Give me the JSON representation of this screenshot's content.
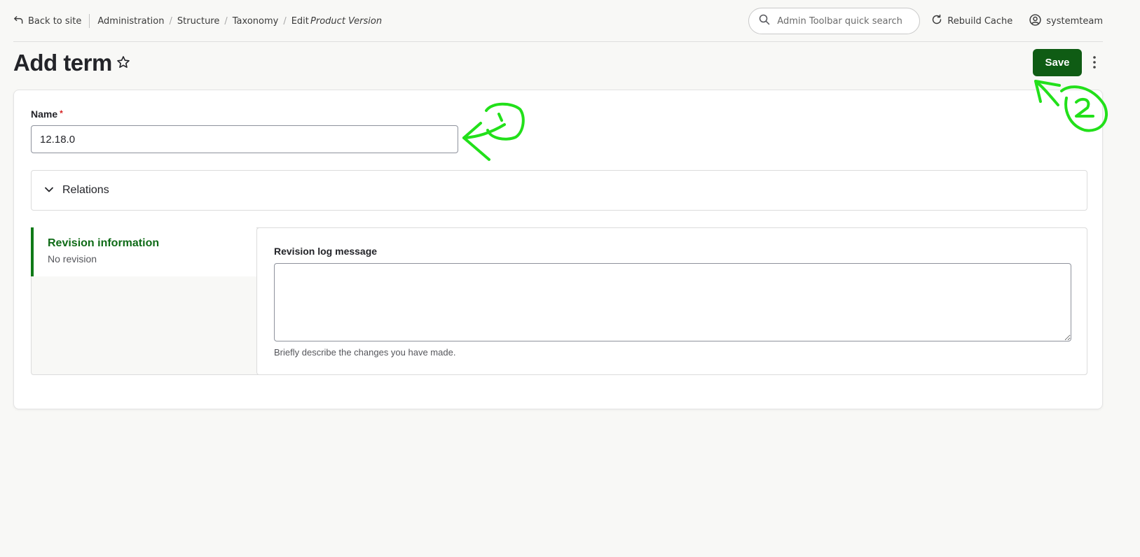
{
  "toolbar": {
    "back_label": "Back to site",
    "breadcrumbs": [
      "Administration",
      "Structure",
      "Taxonomy"
    ],
    "breadcrumb_edit_prefix": "Edit",
    "breadcrumb_edit_entity": "Product Version",
    "search_placeholder": "Admin Toolbar quick search",
    "rebuild_cache_label": "Rebuild Cache",
    "username": "systemteam"
  },
  "header": {
    "title": "Add term",
    "save_label": "Save"
  },
  "form": {
    "name_label": "Name",
    "required_mark": "*",
    "name_value": "12.18.0",
    "relations_label": "Relations",
    "revision": {
      "tab_title": "Revision information",
      "tab_summary": "No revision",
      "log_label": "Revision log message",
      "log_value": "",
      "log_description": "Briefly describe the changes you have made."
    }
  },
  "annotations": {
    "color": "#22e01a",
    "marks": [
      "1",
      "2"
    ]
  },
  "colors": {
    "primary_button": "#0f5c14",
    "active_tab_accent": "#0f7a17",
    "required": "#d72222"
  }
}
